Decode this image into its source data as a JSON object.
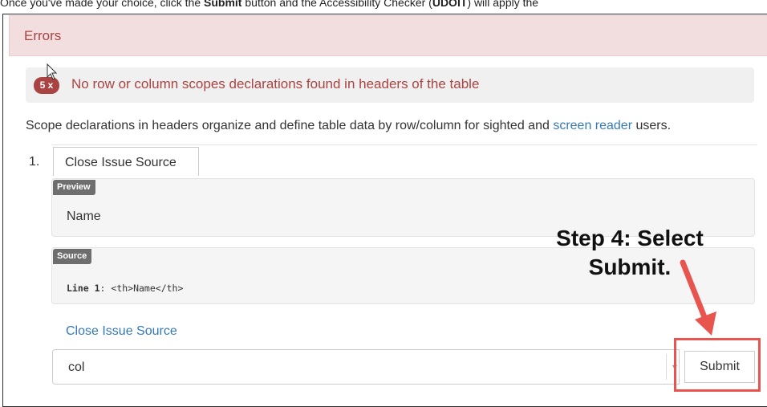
{
  "instruction": {
    "part1": "Once you've made your choice, click the ",
    "bold1": "Submit",
    "part2": " button and the Accessibility Checker (",
    "bold2": "UDOIT",
    "part3": ") will apply the"
  },
  "errors_panel": {
    "title": "Errors",
    "badge": "5 x",
    "issue": "No row or column scopes declarations found in headers of the table",
    "description_before": "Scope declarations in headers organize and define table data by row/column for sighted and ",
    "description_link": "screen reader",
    "description_after": " users."
  },
  "item": {
    "number": "1.",
    "close_source_button": "Close Issue Source",
    "preview_label": "Preview",
    "preview_value": "Name",
    "source_label": "Source",
    "source_line_label": "Line 1",
    "source_code": ": <th>Name</th>",
    "close_source_link": "Close Issue Source",
    "select_value": "col",
    "submit_label": "Submit"
  },
  "callout": {
    "line1": "Step 4: Select",
    "line2": "Submit.",
    "color": "#e8554e"
  }
}
